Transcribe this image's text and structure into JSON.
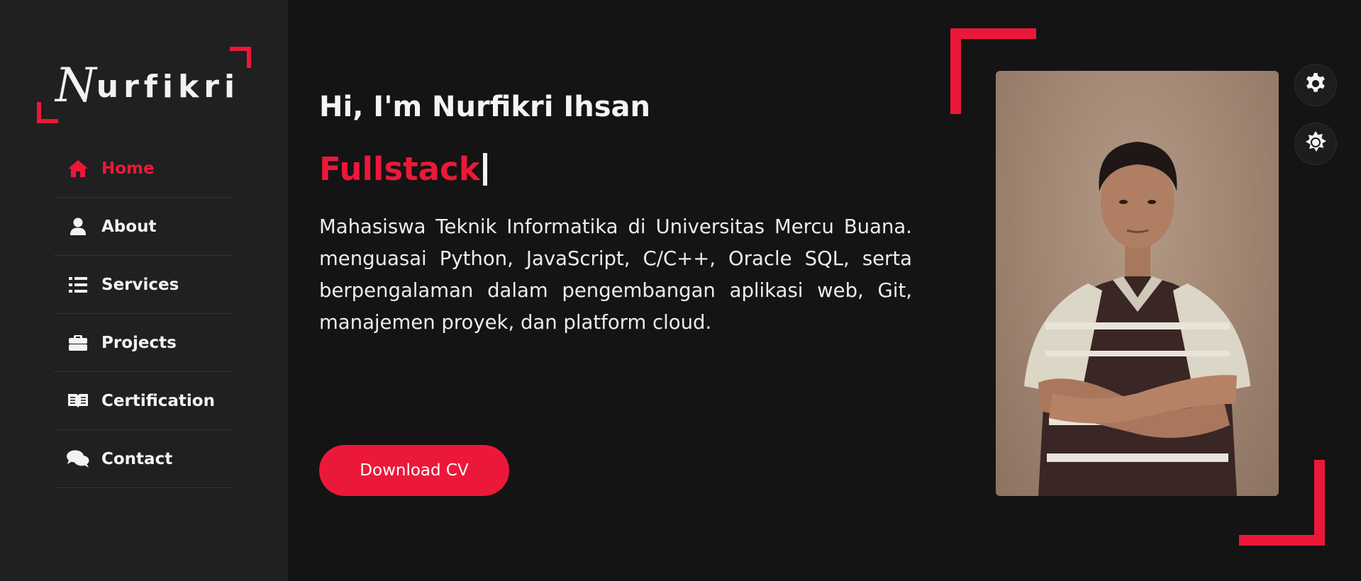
{
  "logo": {
    "initial": "N",
    "rest": "urfikri"
  },
  "nav": {
    "items": [
      {
        "label": "Home",
        "icon": "home-icon",
        "active": true
      },
      {
        "label": "About",
        "icon": "user-icon",
        "active": false
      },
      {
        "label": "Services",
        "icon": "list-icon",
        "active": false
      },
      {
        "label": "Projects",
        "icon": "briefcase-icon",
        "active": false
      },
      {
        "label": "Certification",
        "icon": "book-icon",
        "active": false
      },
      {
        "label": "Contact",
        "icon": "comments-icon",
        "active": false
      }
    ]
  },
  "hero": {
    "greeting": "Hi, I'm Nurfikri Ihsan",
    "role": "Fullstack",
    "bio": "Mahasiswa Teknik Informatika di Universitas Mercu Buana. menguasai Python, JavaScript, C/C++, Oracle SQL, serta berpengalaman dalam pengembangan aplikasi web, Git, manajemen proyek, dan platform cloud.",
    "button_label": "Download CV"
  },
  "toolbar": {
    "settings_icon": "gear-icon",
    "theme_icon": "sun-icon"
  },
  "colors": {
    "accent": "#ec1839",
    "background": "#141414",
    "sidebar": "#202020",
    "text": "#f2f2f2"
  }
}
